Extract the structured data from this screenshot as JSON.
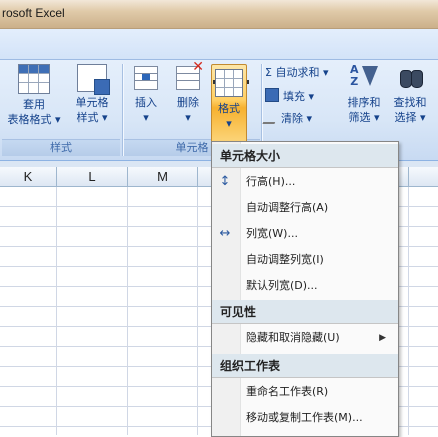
{
  "window": {
    "title": "rosoft Excel"
  },
  "ribbon": {
    "table_format_button": {
      "line1": "套用",
      "line2": "表格格式 ▾"
    },
    "cell_style_button": {
      "line1": "单元格",
      "line2": "样式 ▾"
    },
    "insert_button": {
      "line1": "插入",
      "line2": "▾"
    },
    "delete_button": {
      "line1": "删除",
      "line2": "▾"
    },
    "format_button": {
      "line1": "格式",
      "line2": "▾"
    },
    "autosum": "Σ 自动求和 ▾",
    "fill": "填充 ▾",
    "clear": "清除 ▾",
    "sort_filter": {
      "line1": "排序和",
      "line2": "筛选 ▾"
    },
    "find_select": {
      "line1": "查找和",
      "line2": "选择 ▾"
    },
    "group_styles": "样式",
    "group_cells": "单元格"
  },
  "columns": [
    "K",
    "L",
    "M",
    "",
    "",
    "",
    ""
  ],
  "menu": {
    "section_size": "单元格大小",
    "row_height": "行高(H)...",
    "autofit_row": "自动调整行高(A)",
    "col_width": "列宽(W)...",
    "autofit_col": "自动调整列宽(I)",
    "default_width": "默认列宽(D)...",
    "section_visibility": "可见性",
    "hide_unhide": "隐藏和取消隐藏(U)",
    "section_organize": "组织工作表",
    "rename_sheet": "重命名工作表(R)",
    "move_copy_sheet": "移动或复制工作表(M)..."
  }
}
